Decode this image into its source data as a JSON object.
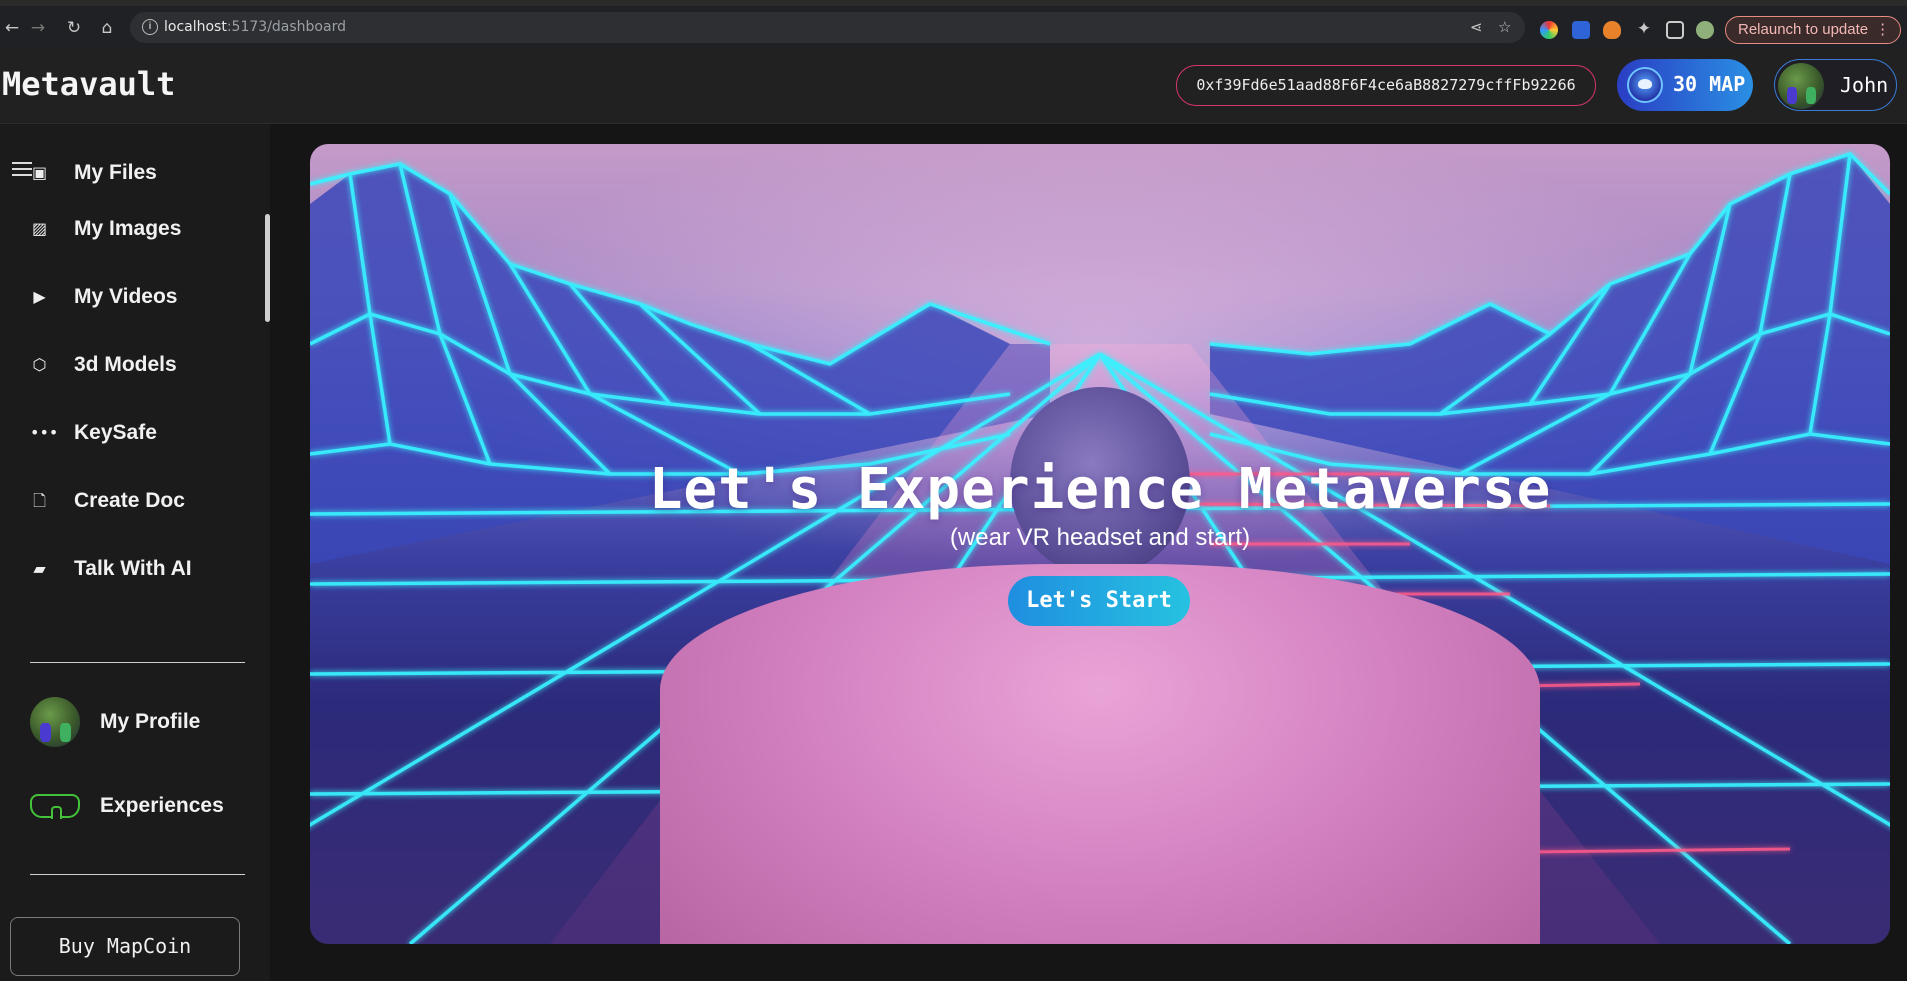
{
  "browser": {
    "url_host": "localhost",
    "url_path": ":5173/dashboard",
    "relaunch_label": "Relaunch to update"
  },
  "header": {
    "logo": "Metavault",
    "wallet_address": "0xf39Fd6e51aad88F6F4ce6aB8827279cffFb92266",
    "coin_balance": "30 MAP",
    "user_name": "John"
  },
  "sidebar": {
    "items": [
      {
        "label": "My Files",
        "icon": "file-icon"
      },
      {
        "label": "My Images",
        "icon": "image-icon"
      },
      {
        "label": "My Videos",
        "icon": "video-icon"
      },
      {
        "label": "3d Models",
        "icon": "cube-icon"
      },
      {
        "label": "KeySafe",
        "icon": "password-icon"
      },
      {
        "label": "Create Doc",
        "icon": "document-icon"
      },
      {
        "label": "Talk With AI",
        "icon": "chat-icon"
      }
    ],
    "profile_label": "My Profile",
    "experiences_label": "Experiences",
    "buy_label": "Buy MapCoin"
  },
  "hero": {
    "title": "Let's Experience Metaverse",
    "subtitle": "(wear VR headset and start)",
    "button_label": "Let's Start"
  },
  "colors": {
    "wallet_border": "#d6356e",
    "coin_gradient_start": "#2a3ec4",
    "coin_gradient_end": "#2a8fe3",
    "start_button_start": "#1f8ee0",
    "start_button_end": "#26c2e0",
    "neon_cyan": "#37f2ff",
    "vr_icon": "#43c23a"
  }
}
